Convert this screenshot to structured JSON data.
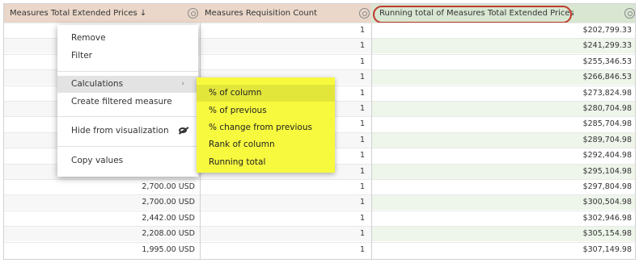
{
  "header": {
    "col1": "Measures Total Extended Prices ↓",
    "col2": "Measures Requisition Count",
    "col3": "Running total of Measures Total Extended Prices"
  },
  "rows": [
    {
      "price": "",
      "count": "1",
      "running": "$202,799.33"
    },
    {
      "price": "",
      "count": "1",
      "running": "$241,299.33"
    },
    {
      "price": "",
      "count": "1",
      "running": "$255,346.53"
    },
    {
      "price": "",
      "count": "1",
      "running": "$266,846.53"
    },
    {
      "price": "",
      "count": "1",
      "running": "$273,824.98"
    },
    {
      "price": "",
      "count": "1",
      "running": "$280,704.98"
    },
    {
      "price": "",
      "count": "1",
      "running": "$285,704.98"
    },
    {
      "price": "",
      "count": "1",
      "running": "$289,704.98"
    },
    {
      "price": "",
      "count": "1",
      "running": "$292,404.98"
    },
    {
      "price": "",
      "count": "1",
      "running": "$295,104.98"
    },
    {
      "price": "2,700.00 USD",
      "count": "1",
      "running": "$297,804.98"
    },
    {
      "price": "2,700.00 USD",
      "count": "1",
      "running": "$300,504.98"
    },
    {
      "price": "2,442.00 USD",
      "count": "1",
      "running": "$302,946.98"
    },
    {
      "price": "2,208.00 USD",
      "count": "1",
      "running": "$305,154.98"
    },
    {
      "price": "1,995.00 USD",
      "count": "1",
      "running": "$307,149.98"
    }
  ],
  "menu": {
    "remove": "Remove",
    "filter": "Filter",
    "calculations": "Calculations",
    "create_filtered": "Create filtered measure",
    "hide": "Hide from visualization",
    "copy": "Copy values"
  },
  "submenu": {
    "pct_column": "% of column",
    "pct_previous": "% of previous",
    "pct_change": "% change from previous",
    "rank": "Rank of column",
    "running_total": "Running total"
  }
}
